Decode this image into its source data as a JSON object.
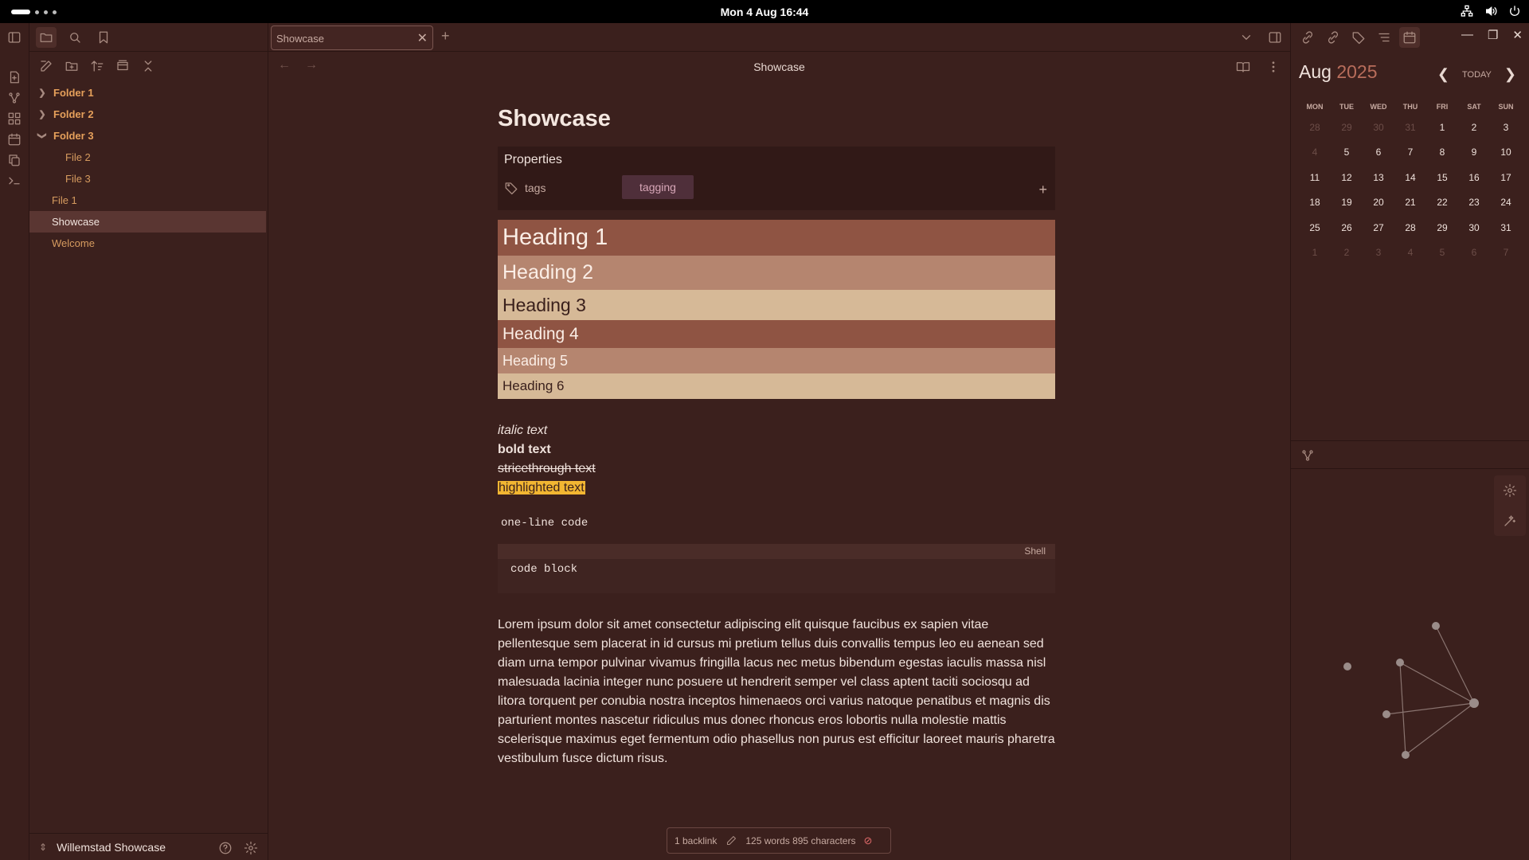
{
  "system": {
    "clock": "Mon 4 Aug  16:44"
  },
  "sidebar": {
    "tree": [
      {
        "label": "Folder 1",
        "type": "folder",
        "expanded": false
      },
      {
        "label": "Folder 2",
        "type": "folder",
        "expanded": false
      },
      {
        "label": "Folder 3",
        "type": "folder",
        "expanded": true
      },
      {
        "label": "File 2",
        "type": "file",
        "indent": 2
      },
      {
        "label": "File 3",
        "type": "file",
        "indent": 2
      },
      {
        "label": "File 1",
        "type": "file",
        "indent": 1
      },
      {
        "label": "Showcase",
        "type": "file",
        "indent": 1,
        "active": true
      },
      {
        "label": "Welcome",
        "type": "file",
        "indent": 1
      }
    ],
    "vault_name": "Willemstad Showcase"
  },
  "tabs": {
    "active_tab": "Showcase",
    "new_tab": "+"
  },
  "view": {
    "title": "Showcase"
  },
  "note": {
    "title": "Showcase",
    "properties": {
      "heading": "Properties",
      "key": "tags",
      "tag_value": "tagging"
    },
    "headings": [
      "Heading 1",
      "Heading 2",
      "Heading 3",
      "Heading 4",
      "Heading 5",
      "Heading 6"
    ],
    "italic": "italic text",
    "bold": "bold text",
    "strike": "stricethrough text",
    "highlight": "highlighted text",
    "inline_code": "one-line code",
    "code_block": {
      "language": "Shell",
      "code": "code block"
    },
    "paragraph": "Lorem ipsum dolor sit amet consectetur adipiscing elit quisque faucibus ex sapien vitae pellentesque sem placerat in id cursus mi pretium tellus duis convallis tempus leo eu aenean sed diam urna tempor pulvinar vivamus fringilla lacus nec metus bibendum egestas iaculis massa nisl malesuada lacinia integer nunc posuere ut hendrerit semper vel class aptent taciti sociosqu ad litora torquent per conubia nostra inceptos himenaeos orci varius natoque penatibus et magnis dis parturient montes nascetur ridiculus mus donec rhoncus eros lobortis nulla molestie mattis scelerisque maximus eget fermentum odio phasellus non purus est efficitur laoreet mauris pharetra vestibulum fusce dictum risus."
  },
  "status": {
    "backlinks": "1 backlink",
    "counts": "125 words 895 characters"
  },
  "calendar": {
    "month": "Aug",
    "year": "2025",
    "today_label": "TODAY",
    "weekdays": [
      "MON",
      "TUE",
      "WED",
      "THU",
      "FRI",
      "SAT",
      "SUN"
    ],
    "weeks": [
      [
        "28",
        "29",
        "30",
        "31",
        "1",
        "2",
        "3"
      ],
      [
        "4",
        "5",
        "6",
        "7",
        "8",
        "9",
        "10"
      ],
      [
        "11",
        "12",
        "13",
        "14",
        "15",
        "16",
        "17"
      ],
      [
        "18",
        "19",
        "20",
        "21",
        "22",
        "23",
        "24"
      ],
      [
        "25",
        "26",
        "27",
        "28",
        "29",
        "30",
        "31"
      ],
      [
        "1",
        "2",
        "3",
        "4",
        "5",
        "6",
        "7"
      ]
    ],
    "dimmed": [
      [
        0,
        0
      ],
      [
        0,
        1
      ],
      [
        0,
        2
      ],
      [
        0,
        3
      ],
      [
        1,
        0
      ],
      [
        5,
        0
      ],
      [
        5,
        1
      ],
      [
        5,
        2
      ],
      [
        5,
        3
      ],
      [
        5,
        4
      ],
      [
        5,
        5
      ],
      [
        5,
        6
      ]
    ]
  },
  "colors": {
    "accent": "#e6a05b",
    "highlight": "#f2b632",
    "tag": "#d8a7b8"
  }
}
